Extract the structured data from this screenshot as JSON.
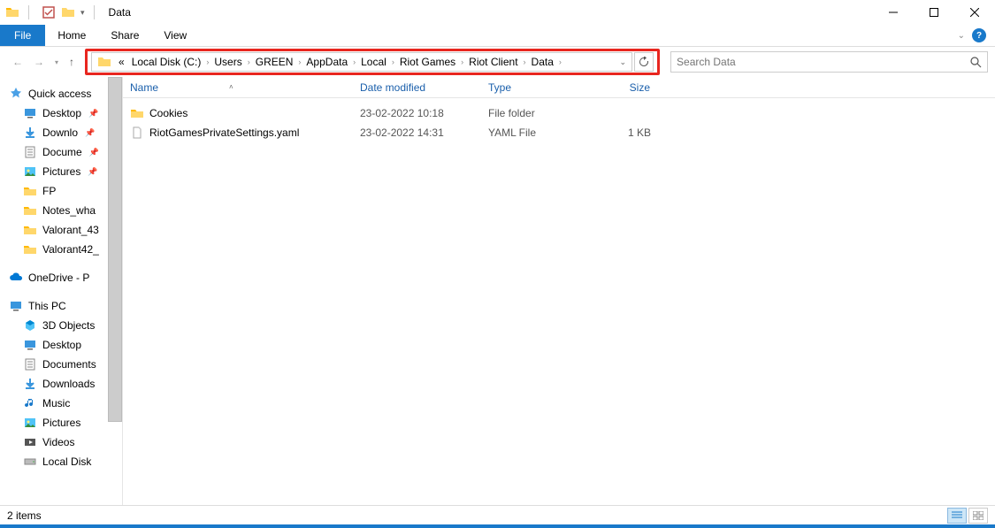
{
  "window": {
    "title": "Data"
  },
  "ribbon": {
    "file": "File",
    "tabs": [
      "Home",
      "Share",
      "View"
    ]
  },
  "breadcrumb": {
    "prefix": "«",
    "items": [
      "Local Disk (C:)",
      "Users",
      "GREEN",
      "AppData",
      "Local",
      "Riot Games",
      "Riot Client",
      "Data"
    ]
  },
  "search": {
    "placeholder": "Search Data"
  },
  "columns": {
    "name": "Name",
    "date": "Date modified",
    "type": "Type",
    "size": "Size"
  },
  "files": [
    {
      "name": "Cookies",
      "date": "23-02-2022 10:18",
      "type": "File folder",
      "size": "",
      "icon": "folder"
    },
    {
      "name": "RiotGamesPrivateSettings.yaml",
      "date": "23-02-2022 14:31",
      "type": "YAML File",
      "size": "1 KB",
      "icon": "file"
    }
  ],
  "sidebar": {
    "quick": "Quick access",
    "quick_items": [
      {
        "label": "Desktop",
        "icon": "desktop",
        "pin": true
      },
      {
        "label": "Downlo",
        "icon": "down",
        "pin": true
      },
      {
        "label": "Docume",
        "icon": "doc",
        "pin": true
      },
      {
        "label": "Pictures",
        "icon": "pic",
        "pin": true
      },
      {
        "label": "FP",
        "icon": "folder",
        "pin": false
      },
      {
        "label": "Notes_wha",
        "icon": "folder",
        "pin": false
      },
      {
        "label": "Valorant_43",
        "icon": "folder",
        "pin": false
      },
      {
        "label": "Valorant42_",
        "icon": "folder",
        "pin": false
      }
    ],
    "onedrive": "OneDrive - P",
    "thispc": "This PC",
    "pc_items": [
      {
        "label": "3D Objects",
        "icon": "cube"
      },
      {
        "label": "Desktop",
        "icon": "desktop"
      },
      {
        "label": "Documents",
        "icon": "doc"
      },
      {
        "label": "Downloads",
        "icon": "down"
      },
      {
        "label": "Music",
        "icon": "music"
      },
      {
        "label": "Pictures",
        "icon": "pic"
      },
      {
        "label": "Videos",
        "icon": "video"
      },
      {
        "label": "Local Disk",
        "icon": "disk"
      }
    ]
  },
  "status": {
    "text": "2 items"
  }
}
